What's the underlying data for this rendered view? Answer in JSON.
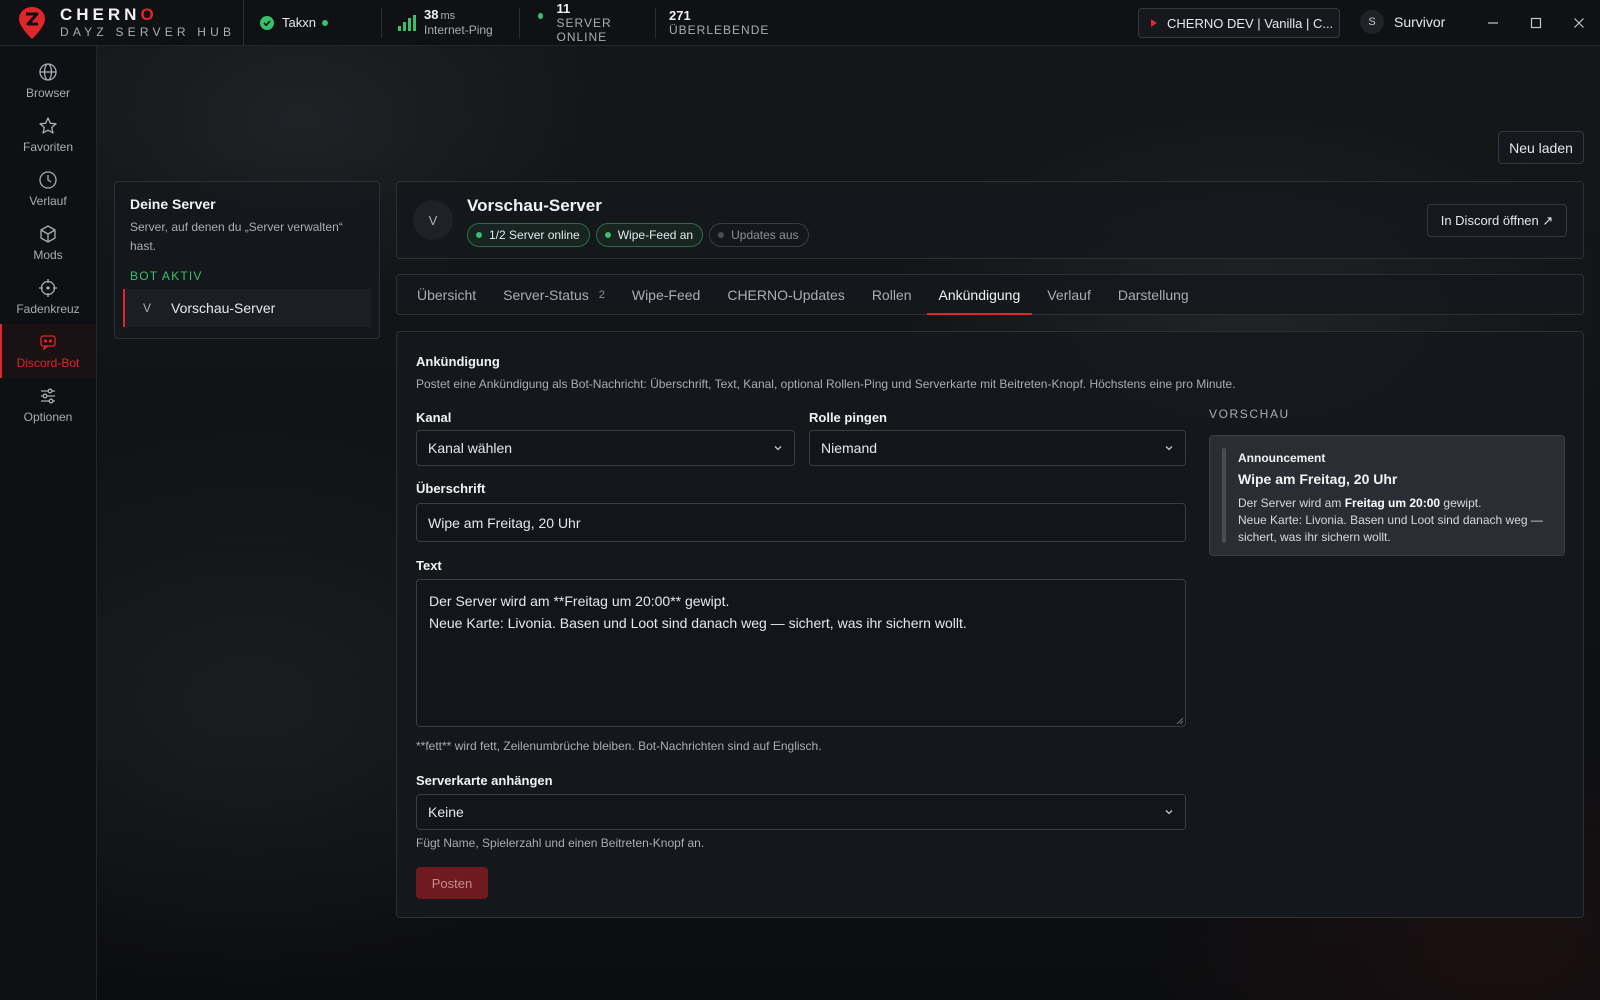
{
  "app": {
    "logo_name_main": "CHERN",
    "logo_name_accent": "O",
    "logo_sub": "DAYZ SERVER HUB",
    "accent": "#e0262b",
    "online_color": "#3ac06b"
  },
  "topbar": {
    "user": "Takxn",
    "ping_value": "38",
    "ping_unit": "ms",
    "ping_label": "Internet-Ping",
    "servers_online_value": "11",
    "servers_online_label": "SERVER ONLINE",
    "survivors_value": "271",
    "survivors_label": "ÜBERLEBENDE",
    "server_select": "CHERNO DEV | Vanilla | C...",
    "profile_initial": "S",
    "profile_name": "Survivor"
  },
  "sidebar": {
    "items": [
      {
        "label": "Browser",
        "icon": "globe-icon"
      },
      {
        "label": "Favoriten",
        "icon": "star-icon"
      },
      {
        "label": "Verlauf",
        "icon": "clock-icon"
      },
      {
        "label": "Mods",
        "icon": "cube-icon"
      },
      {
        "label": "Fadenkreuz",
        "icon": "crosshair-icon"
      },
      {
        "label": "Discord-Bot",
        "icon": "bot-icon",
        "active": true
      },
      {
        "label": "Optionen",
        "icon": "sliders-icon"
      }
    ]
  },
  "reload_label": "Neu laden",
  "left_panel": {
    "title": "Deine Server",
    "description": "Server, auf denen du „Server verwalten“ hast.",
    "status": "BOT AKTIV",
    "server_initial": "V",
    "server_name": "Vorschau-Server"
  },
  "server_header": {
    "initial": "V",
    "title": "Vorschau-Server",
    "badges": [
      "1/2 Server online",
      "Wipe-Feed an",
      "Updates aus"
    ],
    "discord_button": "In Discord öffnen ↗"
  },
  "tabs": [
    {
      "label": "Übersicht"
    },
    {
      "label": "Server-Status",
      "count": "2"
    },
    {
      "label": "Wipe-Feed"
    },
    {
      "label": "CHERNO-Updates"
    },
    {
      "label": "Rollen"
    },
    {
      "label": "Ankündigung",
      "active": true
    },
    {
      "label": "Verlauf"
    },
    {
      "label": "Darstellung"
    }
  ],
  "announcement": {
    "title": "Ankündigung",
    "description": "Postet eine Ankündigung als Bot-Nachricht: Überschrift, Text, Kanal, optional Rollen-Ping und Serverkarte mit Beitreten-Knopf. Höchstens eine pro Minute.",
    "channel_label": "Kanal",
    "channel_value": "Kanal wählen",
    "role_label": "Rolle pingen",
    "role_value": "Niemand",
    "heading_label": "Überschrift",
    "heading_value": "Wipe am Freitag, 20 Uhr",
    "text_label": "Text",
    "text_value": "Der Server wird am **Freitag um 20:00** gewipt.\nNeue Karte: Livonia. Basen und Loot sind danach weg — sichert, was ihr sichern wollt.",
    "text_hint": "**fett** wird fett, Zeilenumbrüche bleiben. Bot-Nachrichten sind auf Englisch.",
    "card_label": "Serverkarte anhängen",
    "card_value": "Keine",
    "card_hint": "Fügt Name, Spielerzahl und einen Beitreten-Knopf an.",
    "post_button": "Posten"
  },
  "preview": {
    "label": "VORSCHAU",
    "author": "Announcement",
    "title": "Wipe am Freitag, 20 Uhr",
    "body_pre": "Der Server wird am ",
    "body_bold": "Freitag um 20:00",
    "body_post": " gewipt.",
    "body_line2": "Neue Karte: Livonia. Basen und Loot sind danach weg — sichert, was ihr sichern wollt."
  }
}
